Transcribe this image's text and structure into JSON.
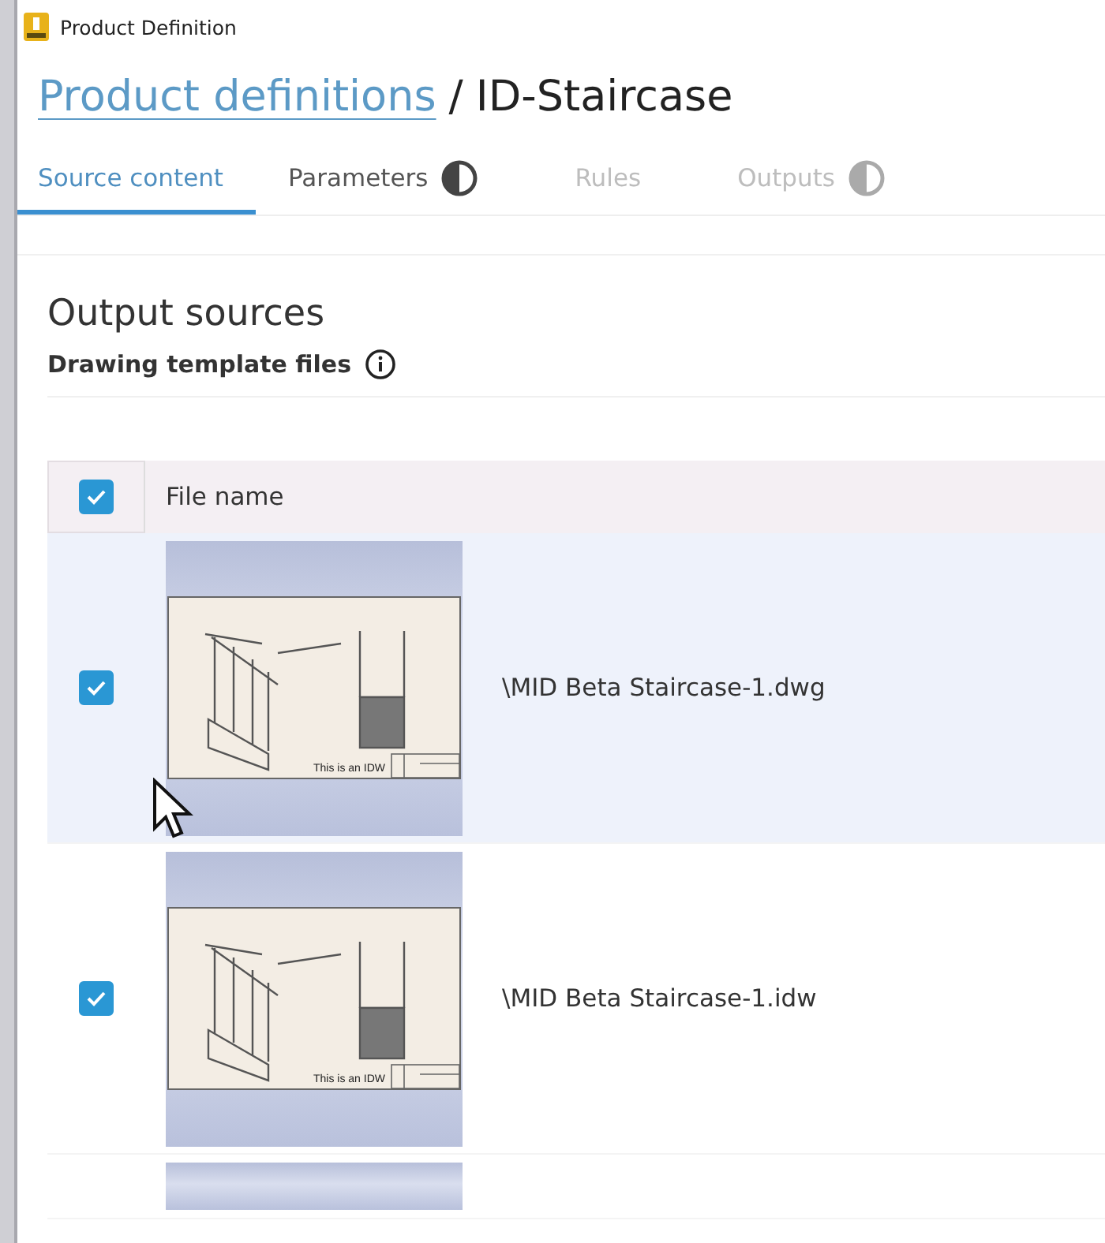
{
  "window": {
    "title": "Product Definition"
  },
  "breadcrumb": {
    "link": "Product definitions",
    "separator": "/",
    "current": "ID-Staircase"
  },
  "tabs": [
    {
      "label": "Source content",
      "selected": true,
      "disabled": false,
      "indicator": false
    },
    {
      "label": "Parameters",
      "selected": false,
      "disabled": false,
      "indicator": true
    },
    {
      "label": "Rules",
      "selected": false,
      "disabled": true,
      "indicator": false
    },
    {
      "label": "Outputs",
      "selected": false,
      "disabled": true,
      "indicator": true
    }
  ],
  "section": {
    "title": "Output sources",
    "subtitle": "Drawing template files"
  },
  "table": {
    "header_checked": true,
    "columns": [
      "File name"
    ],
    "rows": [
      {
        "selected": true,
        "checked": true,
        "file_name": "\\MID Beta Staircase-1.dwg",
        "thumbnail_caption": "This is an IDW"
      },
      {
        "selected": false,
        "checked": true,
        "file_name": "\\MID Beta Staircase-1.idw",
        "thumbnail_caption": "This is an IDW"
      }
    ]
  }
}
